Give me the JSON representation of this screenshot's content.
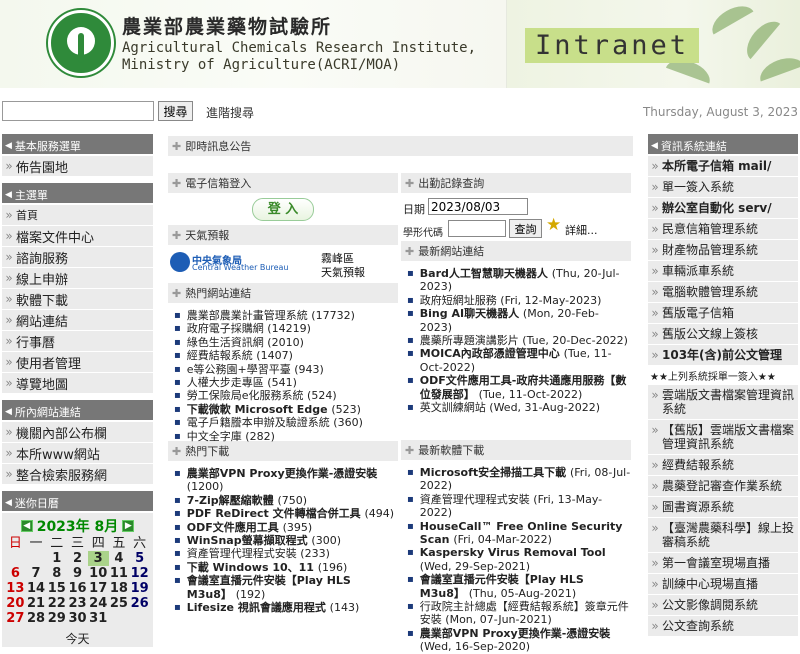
{
  "header": {
    "institute_zh": "農業部農業藥物試驗所",
    "institute_en_line1": "Agricultural Chemicals Research Institute,",
    "institute_en_line2": "Ministry of Agriculture(ACRI/MOA)",
    "intranet_label": "Intranet"
  },
  "topbar": {
    "search_placeholder": "",
    "search_button": "搜尋",
    "advanced_search": "進階搜尋",
    "date": "Thursday, August 3, 2023"
  },
  "left": {
    "basic_menu_title": "基本服務選單",
    "basic_items": [
      "佈告園地"
    ],
    "main_menu_title": "主選單",
    "main_items": [
      "首頁",
      "檔案文件中心",
      "諮詢服務",
      "線上申辦",
      "軟體下載",
      "網站連結",
      "行事曆",
      "使用者管理",
      "導覽地圖"
    ],
    "inner_links_title": "所內網站連結",
    "inner_items": [
      "機關內部公布欄",
      "本所www網站",
      "整合檢索服務網"
    ],
    "calendar_title": "迷你日曆",
    "calendar": {
      "year_month": "2023年 8月",
      "weekdays": [
        "日",
        "一",
        "二",
        "三",
        "四",
        "五",
        "六"
      ],
      "weeks": [
        [
          "",
          "",
          "1",
          "2",
          "3",
          "4",
          "5"
        ],
        [
          "6",
          "7",
          "8",
          "9",
          "10",
          "11",
          "12"
        ],
        [
          "13",
          "14",
          "15",
          "16",
          "17",
          "18",
          "19"
        ],
        [
          "20",
          "21",
          "22",
          "23",
          "24",
          "25",
          "26"
        ],
        [
          "27",
          "28",
          "29",
          "30",
          "31",
          "",
          ""
        ]
      ],
      "today_day": "3",
      "today_label": "今天"
    }
  },
  "main": {
    "announce_title": "即時訊息公告",
    "email_login_title": "電子信箱登入",
    "login_button": "登 入",
    "weather_title": "天氣預報",
    "cwb_zh": "中央氣象局",
    "cwb_en": "Central Weather Bureau",
    "weather_region": "霧峰區",
    "weather_text": "天氣預報",
    "hot_sites_title": "熱門網站連結",
    "hot_sites": [
      [
        "農業部農業計畫管理系統 ",
        "(17732)"
      ],
      [
        "政府電子採購網 ",
        "(14219)"
      ],
      [
        "綠色生活資訊網 ",
        "(2010)"
      ],
      [
        "經費結報系統 ",
        "(1407)"
      ],
      [
        "e等公務園+學習平臺 ",
        "(943)"
      ],
      [
        "人權大步走專區 ",
        "(541)"
      ],
      [
        "勞工保險局e化服務系統 ",
        "(524)"
      ],
      [
        "下載微軟 Microsoft Edge ",
        "(523)"
      ],
      [
        "電子戶籍謄本申辦及驗證系統 ",
        "(360)"
      ],
      [
        "中文全字庫 ",
        "(282)"
      ]
    ],
    "hot_downloads_title": "熱門下載",
    "hot_downloads": [
      [
        "農業部VPN Proxy更換作業-憑證安裝 ",
        "(1200)"
      ],
      [
        "7-Zip解壓縮軟體 ",
        "(750)"
      ],
      [
        "PDF ReDirect 文件轉檔合併工具 ",
        "(494)"
      ],
      [
        "ODF文件應用工具 ",
        "(395)"
      ],
      [
        "WinSnap螢幕擷取程式 ",
        "(300)"
      ],
      [
        "資產管理代理程式安裝 ",
        "(233)"
      ],
      [
        "下載 Windows 10、11 ",
        "(196)"
      ],
      [
        "會議室直播元件安裝【Play HLS M3u8】 ",
        "(192)"
      ],
      [
        "Lifesize 視訊會議應用程式 ",
        "(143)"
      ]
    ],
    "attendance_title": "出勤記錄查詢",
    "attendance_date_label": "日期",
    "attendance_date_value": "2023/08/03",
    "employee_id_label": "學形代碼",
    "query_button": "查詢",
    "details_link": "詳細...",
    "latest_sites_title": "最新網站連結",
    "latest_sites": [
      [
        "Bard人工智慧聊天機器人 ",
        "(Thu, 20-Jul-2023)"
      ],
      [
        "政府短網址服務 ",
        "(Fri, 12-May-2023)"
      ],
      [
        "Bing AI聊天機器人 ",
        "(Mon, 20-Feb-2023)"
      ],
      [
        "農藥所專題演講影片 ",
        "(Tue, 20-Dec-2022)"
      ],
      [
        "MOICA內政部憑證管理中心 ",
        "(Tue, 11-Oct-2022)"
      ],
      [
        "ODF文件應用工具-政府共通應用服務【數位發展部】 ",
        "(Tue, 11-Oct-2022)"
      ],
      [
        "英文訓練網站 ",
        "(Wed, 31-Aug-2022)"
      ]
    ],
    "latest_software_title": "最新軟體下載",
    "latest_software": [
      [
        "Microsoft安全掃描工具下載 ",
        "(Fri, 08-Jul-2022)"
      ],
      [
        "資產管理代理程式安裝 ",
        "(Fri, 13-May-2022)"
      ],
      [
        "HouseCall™ Free Online Security Scan ",
        "(Fri, 04-Mar-2022)"
      ],
      [
        "Kaspersky Virus Removal Tool ",
        "(Wed, 29-Sep-2021)"
      ],
      [
        "會議室直播元件安裝【Play HLS M3u8】 ",
        "(Thu, 05-Aug-2021)"
      ],
      [
        "行政院主計總處【經費結報系統】簽章元件安裝 ",
        "(Mon, 07-Jun-2021)"
      ],
      [
        "農業部VPN Proxy更換作業-憑證安裝 ",
        "(Wed, 16-Sep-2020)"
      ]
    ]
  },
  "right": {
    "title": "資訊系統連結",
    "items_a": [
      "本所電子信箱 mail/",
      "單一簽入系統",
      "辦公室自動化 serv/",
      "民意信箱管理系統",
      "財產物品管理系統",
      "車輛派車系統",
      "電腦軟體管理系統",
      "舊版電子信箱",
      "舊版公文線上簽核",
      "103年(含)前公文管理"
    ],
    "sso_note": "★★上列系統採單一簽入★★",
    "items_b": [
      "雲端版文書檔案管理資訊系統",
      "【舊版】雲端版文書檔案管理資訊系統",
      "經費結報系統",
      "農藥登記審查作業系統",
      "圖書資源系統",
      "【臺灣農藥科學】線上投審稿系統",
      "第一會議室現場直播",
      "訓練中心現場直播",
      "公文影像調閱系統",
      "公文查詢系統"
    ]
  }
}
